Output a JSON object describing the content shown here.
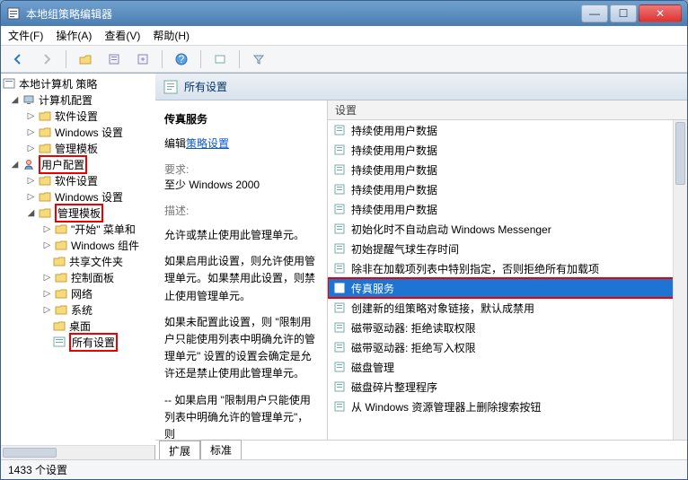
{
  "window": {
    "title": "本地组策略编辑器"
  },
  "win_buttons": {
    "min": "—",
    "max": "☐",
    "close": "✕"
  },
  "menu": [
    "文件(F)",
    "操作(A)",
    "查看(V)",
    "帮助(H)"
  ],
  "header": {
    "title": "所有设置"
  },
  "tree": {
    "root": "本地计算机 策略",
    "computer": "计算机配置",
    "c_software": "软件设置",
    "c_windows": "Windows 设置",
    "c_admin": "管理模板",
    "user": "用户配置",
    "u_software": "软件设置",
    "u_windows": "Windows 设置",
    "u_admin": "管理模板",
    "start": "\"开始\" 菜单和",
    "wincomp": "Windows 组件",
    "share": "共享文件夹",
    "ctrlpanel": "控制面板",
    "network": "网络",
    "system": "系统",
    "desktop": "桌面",
    "allsettings": "所有设置"
  },
  "desc": {
    "title": "传真服务",
    "edit_link_prefix": "编辑",
    "edit_link": "策略设置",
    "req_label": "要求:",
    "req_value": "至少 Windows 2000",
    "desc_label": "描述:",
    "p1": "允许或禁止使用此管理单元。",
    "p2": "如果启用此设置，则允许使用管理单元。如果禁用此设置，则禁止使用管理单元。",
    "p3": "如果未配置此设置，则 \"限制用户只能使用列表中明确允许的管理单元\" 设置的设置会确定是允许还是禁止使用此管理单元。",
    "p4": "-- 如果启用 \"限制用户只能使用列表中明确允许的管理单元\"，则"
  },
  "list": {
    "column": "设置",
    "items": [
      {
        "label": "持续使用用户数据",
        "sel": false
      },
      {
        "label": "持续使用用户数据",
        "sel": false
      },
      {
        "label": "持续使用用户数据",
        "sel": false
      },
      {
        "label": "持续使用用户数据",
        "sel": false
      },
      {
        "label": "持续使用用户数据",
        "sel": false
      },
      {
        "label": "初始化时不自动启动 Windows Messenger",
        "sel": false
      },
      {
        "label": "初始提醒气球生存时间",
        "sel": false
      },
      {
        "label": "除非在加载项列表中特别指定，否则拒绝所有加载项",
        "sel": false
      },
      {
        "label": "传真服务",
        "sel": true,
        "hilite": true
      },
      {
        "label": "创建新的组策略对象链接，默认成禁用",
        "sel": false
      },
      {
        "label": "磁带驱动器: 拒绝读取权限",
        "sel": false
      },
      {
        "label": "磁带驱动器: 拒绝写入权限",
        "sel": false
      },
      {
        "label": "磁盘管理",
        "sel": false
      },
      {
        "label": "磁盘碎片整理程序",
        "sel": false
      },
      {
        "label": "从 Windows 资源管理器上删除搜索按钮",
        "sel": false
      }
    ]
  },
  "tabs": {
    "extend": "扩展",
    "standard": "标准"
  },
  "status": "1433 个设置"
}
